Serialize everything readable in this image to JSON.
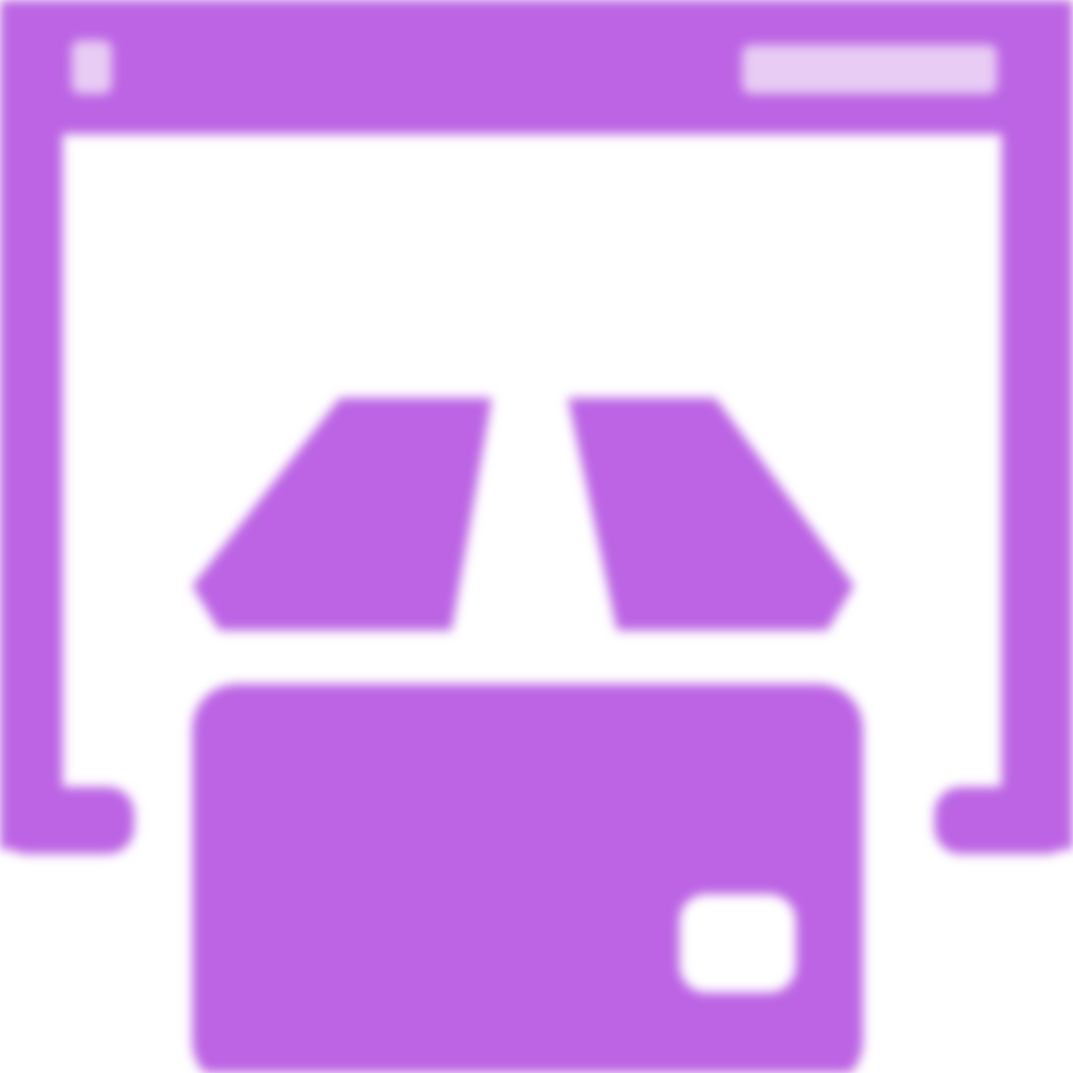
{
  "icon": {
    "name": "browser-package-icon",
    "accent_color": "#BC64E4",
    "highlight_color": "#E8CCF4",
    "background_color": "#FFFFFF"
  }
}
